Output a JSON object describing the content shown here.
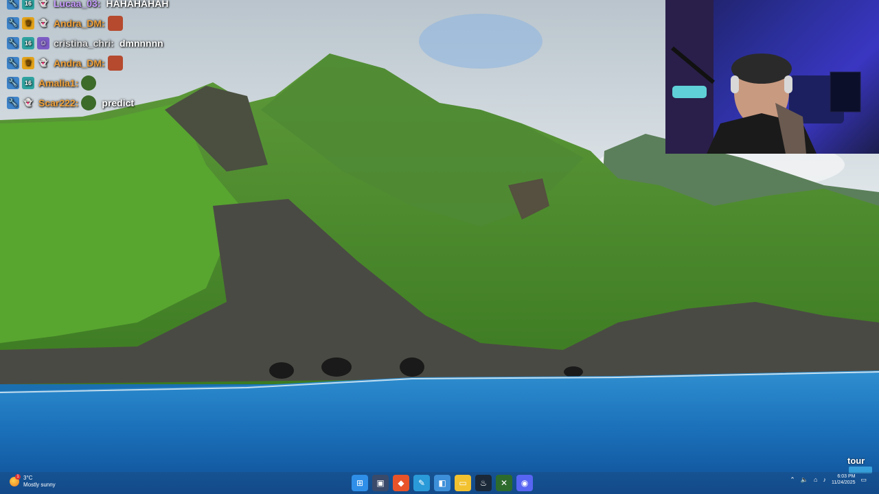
{
  "chat": {
    "messages": [
      {
        "badges": [
          "wrench",
          "tier",
          "ghost"
        ],
        "name": "Lucaa_03:",
        "name_color": "#c79bff",
        "text": "HAHAHAHAH",
        "emote": null
      },
      {
        "badges": [
          "wrench",
          "crown",
          "ghost"
        ],
        "name": "Andra_DM:",
        "name_color": "#f0a13a",
        "text": "",
        "emote": "face"
      },
      {
        "badges": [
          "wrench",
          "tier",
          "sub"
        ],
        "name": "cristina_chri:",
        "name_color": "#e0e0e0",
        "text": "dmnnnnn",
        "emote": null
      },
      {
        "badges": [
          "wrench",
          "crown",
          "ghost"
        ],
        "name": "Andra_DM:",
        "name_color": "#f0a13a",
        "text": "",
        "emote": "face"
      },
      {
        "badges": [
          "wrench",
          "tier"
        ],
        "name": "Amalia1:",
        "name_color": "#f0a13a",
        "text": "",
        "emote": "frog"
      },
      {
        "badges": [
          "wrench",
          "ghost"
        ],
        "name": "Scar222:",
        "name_color": "#f0a13a",
        "text": "predict",
        "emote": "frog"
      }
    ]
  },
  "taskbar": {
    "weather": {
      "temp": "3°C",
      "condition": "Mostly sunny",
      "badge_count": "1"
    },
    "apps": [
      {
        "name": "start-icon",
        "color": "#2f8fe8",
        "glyph": "⊞"
      },
      {
        "name": "task-view-icon",
        "color": "#3a4a6a",
        "glyph": "▣"
      },
      {
        "name": "brave-browser-icon",
        "color": "#e8532a",
        "glyph": "◆"
      },
      {
        "name": "paint-icon",
        "color": "#2a9ad8",
        "glyph": "✎"
      },
      {
        "name": "app-hdr-icon",
        "color": "#3c8fd8",
        "glyph": "◧"
      },
      {
        "name": "file-explorer-icon",
        "color": "#f2c230",
        "glyph": "▭"
      },
      {
        "name": "steam-icon",
        "color": "#1b2838",
        "glyph": "♨"
      },
      {
        "name": "xbox-icon",
        "color": "#2d6b2d",
        "glyph": "✕"
      },
      {
        "name": "discord-icon",
        "color": "#5865f2",
        "glyph": "◉"
      }
    ],
    "tray": {
      "time": "6:03 PM",
      "date": "11/24/2025"
    }
  },
  "watermark": {
    "text": "tour"
  }
}
